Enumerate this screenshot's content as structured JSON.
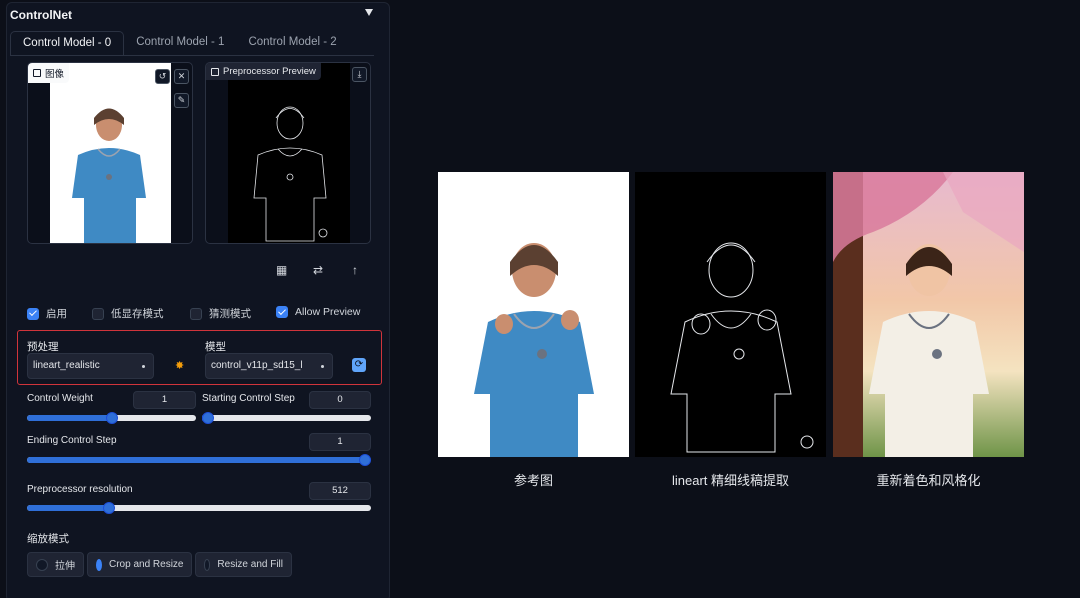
{
  "panel": {
    "title": "ControlNet"
  },
  "tabs": [
    {
      "label": "Control Model - 0",
      "active": true
    },
    {
      "label": "Control Model - 1",
      "active": false
    },
    {
      "label": "Control Model - 2",
      "active": false
    }
  ],
  "image_box": {
    "label": "图像"
  },
  "preview_box": {
    "label": "Preprocessor Preview"
  },
  "checks": [
    {
      "label": "启用",
      "checked": true
    },
    {
      "label": "低显存模式",
      "checked": false
    },
    {
      "label": "猜测模式",
      "checked": false
    },
    {
      "label": "Allow Preview",
      "checked": true
    }
  ],
  "preprocessor": {
    "label": "预处理",
    "value": "lineart_realistic"
  },
  "model": {
    "label": "模型",
    "value": "control_v11p_sd15_l"
  },
  "sliders": {
    "control_weight": {
      "label": "Control Weight",
      "value": "1",
      "fraction": 0.5
    },
    "starting_step": {
      "label": "Starting Control Step",
      "value": "0",
      "fraction": 0.0
    },
    "ending_step": {
      "label": "Ending Control Step",
      "value": "1",
      "fraction": 1.0
    },
    "resolution": {
      "label": "Preprocessor resolution",
      "value": "512",
      "fraction": 0.24
    }
  },
  "resize_mode": {
    "label": "缩放模式",
    "options": [
      {
        "label": "拉伸",
        "selected": false
      },
      {
        "label": "Crop and Resize",
        "selected": true
      },
      {
        "label": "Resize and Fill",
        "selected": false
      }
    ]
  },
  "comparison": {
    "captions": [
      "参考图",
      "lineart 精细线稿提取",
      "重新着色和风格化"
    ]
  },
  "colors": {
    "accent": "#2f6fd8",
    "highlight_border": "#d0343b",
    "background": "#0c0f18"
  }
}
